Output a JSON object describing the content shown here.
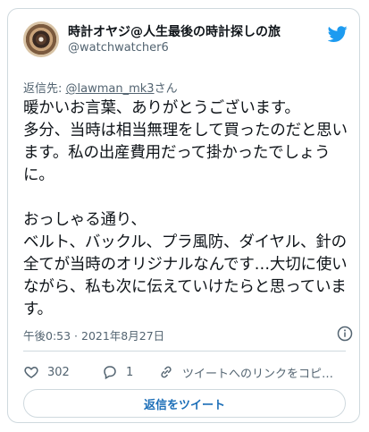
{
  "author": {
    "display_name": "時計オヤジ@人生最後の時計探しの旅",
    "handle": "@watchwatcher6"
  },
  "reply_to": {
    "prefix": "返信先: ",
    "user": "@lawman_mk3",
    "suffix": "さん"
  },
  "tweet": {
    "text": "暖かいお言葉、ありがとうございます。\n多分、当時は相当無理をして買ったのだと思います。私の出産費用だって掛かったでしょうに。\n\nおっしゃる通り、\nベルト、バックル、プラ風防、ダイヤル、針の全てが当時のオリジナルなんです…大切に使いながら、私も次に伝えていけたらと思っています。",
    "timestamp": "午後0:53 · 2021年8月27日"
  },
  "actions": {
    "likes": "302",
    "replies": "1",
    "copy_link": "ツイートへのリンクをコピ…"
  },
  "reply_button": "返信をツイート",
  "colors": {
    "accent": "#1d9bf0",
    "muted": "#536471",
    "border": "#cfd9de"
  },
  "icons": [
    "twitter-logo-icon",
    "info-icon",
    "heart-icon",
    "reply-icon",
    "link-icon"
  ]
}
